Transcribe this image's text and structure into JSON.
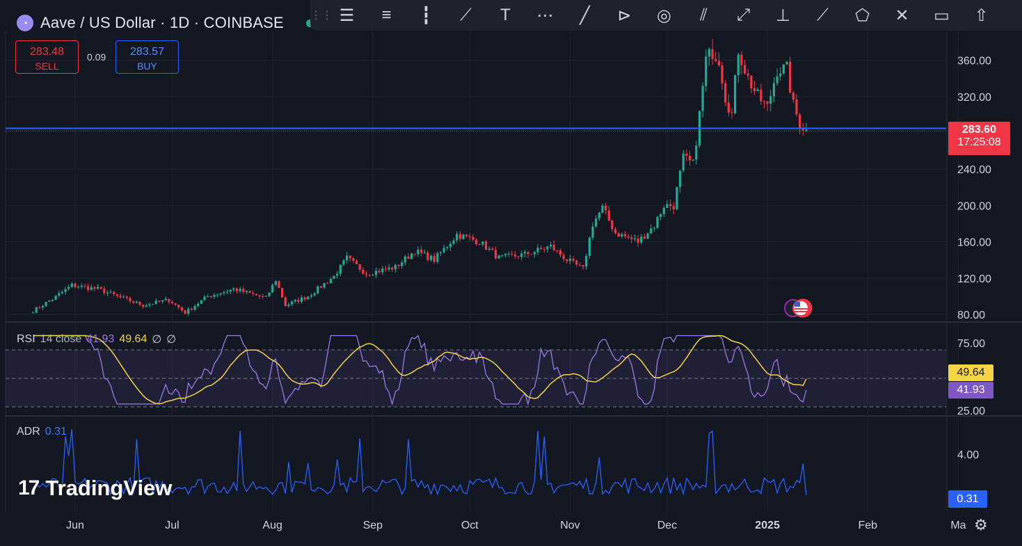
{
  "header": {
    "symbol_title": "Aave / US Dollar · 1D · COINBASE",
    "coin_icon": "aave-ghost-icon",
    "live_indicator_color": "#22ab94"
  },
  "trade": {
    "sell_price": "283.48",
    "sell_label": "SELL",
    "spread": "0.09",
    "buy_price": "283.57",
    "buy_label": "BUY"
  },
  "toolbar": {
    "tools": [
      "grip-icon",
      "trend-line-tools-icon",
      "horizontal-lines-icon",
      "candles-icon",
      "brush-icon",
      "text-icon",
      "pattern-icon",
      "line-icon",
      "fib-icon",
      "circle-icon",
      "parallel-channel-icon",
      "ray-icon",
      "anchored-text-icon",
      "path-icon",
      "polygon-icon",
      "xabcd-icon",
      "callout-icon",
      "arrow-up-icon"
    ]
  },
  "price_badge": {
    "price": "283.60",
    "countdown": "17:25:08",
    "color": "#f23645"
  },
  "rsi": {
    "name": "RSI",
    "params": "14 close",
    "value": "41.93",
    "ma_value": "49.64",
    "extra1": "∅",
    "extra2": "∅"
  },
  "adr": {
    "name": "ADR",
    "value": "0.31"
  },
  "watermark": {
    "logo": "17",
    "text": "TradingView"
  },
  "colors": {
    "up": "#22ab94",
    "down": "#f23645",
    "rsi_line": "#9f7ae6",
    "rsi_ma": "#f5d547",
    "adr_line": "#2962ff",
    "hline": "#2962ff"
  },
  "chart_data": {
    "type": "candlestick",
    "symbol": "AAVE/USD",
    "interval": "1D",
    "x_ticks": [
      "Jun",
      "Jul",
      "Aug",
      "Sep",
      "Oct",
      "Nov",
      "Dec",
      "2025",
      "Feb",
      "Ma"
    ],
    "y_ticks": [
      "360.00",
      "320.00",
      "240.00",
      "200.00",
      "160.00",
      "120.00",
      "80.00"
    ],
    "ylim": [
      75,
      380
    ],
    "horizontal_line": 285,
    "close_anchors": [
      {
        "date": "2024-05-19",
        "v": 84
      },
      {
        "date": "2024-05-25",
        "v": 97
      },
      {
        "date": "2024-05-31",
        "v": 112
      },
      {
        "date": "2024-06-08",
        "v": 108
      },
      {
        "date": "2024-06-14",
        "v": 100
      },
      {
        "date": "2024-06-22",
        "v": 90
      },
      {
        "date": "2024-06-30",
        "v": 96
      },
      {
        "date": "2024-07-05",
        "v": 82
      },
      {
        "date": "2024-07-12",
        "v": 100
      },
      {
        "date": "2024-07-20",
        "v": 108
      },
      {
        "date": "2024-07-30",
        "v": 98
      },
      {
        "date": "2024-08-02",
        "v": 118
      },
      {
        "date": "2024-08-05",
        "v": 90
      },
      {
        "date": "2024-08-12",
        "v": 100
      },
      {
        "date": "2024-08-20",
        "v": 122
      },
      {
        "date": "2024-08-24",
        "v": 142
      },
      {
        "date": "2024-08-30",
        "v": 125
      },
      {
        "date": "2024-09-08",
        "v": 132
      },
      {
        "date": "2024-09-14",
        "v": 150
      },
      {
        "date": "2024-09-20",
        "v": 140
      },
      {
        "date": "2024-09-27",
        "v": 168
      },
      {
        "date": "2024-10-04",
        "v": 160
      },
      {
        "date": "2024-10-10",
        "v": 142
      },
      {
        "date": "2024-10-18",
        "v": 146
      },
      {
        "date": "2024-10-26",
        "v": 155
      },
      {
        "date": "2024-10-31",
        "v": 140
      },
      {
        "date": "2024-11-05",
        "v": 130
      },
      {
        "date": "2024-11-08",
        "v": 180
      },
      {
        "date": "2024-11-11",
        "v": 197
      },
      {
        "date": "2024-11-15",
        "v": 170
      },
      {
        "date": "2024-11-22",
        "v": 160
      },
      {
        "date": "2024-11-27",
        "v": 178
      },
      {
        "date": "2024-11-30",
        "v": 200
      },
      {
        "date": "2024-12-03",
        "v": 200
      },
      {
        "date": "2024-12-06",
        "v": 252
      },
      {
        "date": "2024-12-09",
        "v": 245
      },
      {
        "date": "2024-12-11",
        "v": 300
      },
      {
        "date": "2024-12-13",
        "v": 360
      },
      {
        "date": "2024-12-15",
        "v": 370
      },
      {
        "date": "2024-12-17",
        "v": 362
      },
      {
        "date": "2024-12-19",
        "v": 320
      },
      {
        "date": "2024-12-21",
        "v": 300
      },
      {
        "date": "2024-12-23",
        "v": 372
      },
      {
        "date": "2024-12-26",
        "v": 340
      },
      {
        "date": "2024-12-29",
        "v": 320
      },
      {
        "date": "2025-01-01",
        "v": 308
      },
      {
        "date": "2025-01-04",
        "v": 350
      },
      {
        "date": "2025-01-07",
        "v": 350
      },
      {
        "date": "2025-01-09",
        "v": 310
      },
      {
        "date": "2025-01-11",
        "v": 290
      },
      {
        "date": "2025-01-13",
        "v": 283.6
      }
    ],
    "rsi": {
      "ylim": [
        25,
        80
      ],
      "levels": [
        70,
        50,
        30
      ],
      "ticks": [
        "75.00",
        "25.00"
      ],
      "last": 41.93,
      "ma_last": 49.64
    },
    "adr": {
      "ticks": [
        "4.00"
      ],
      "last": 0.31
    }
  }
}
